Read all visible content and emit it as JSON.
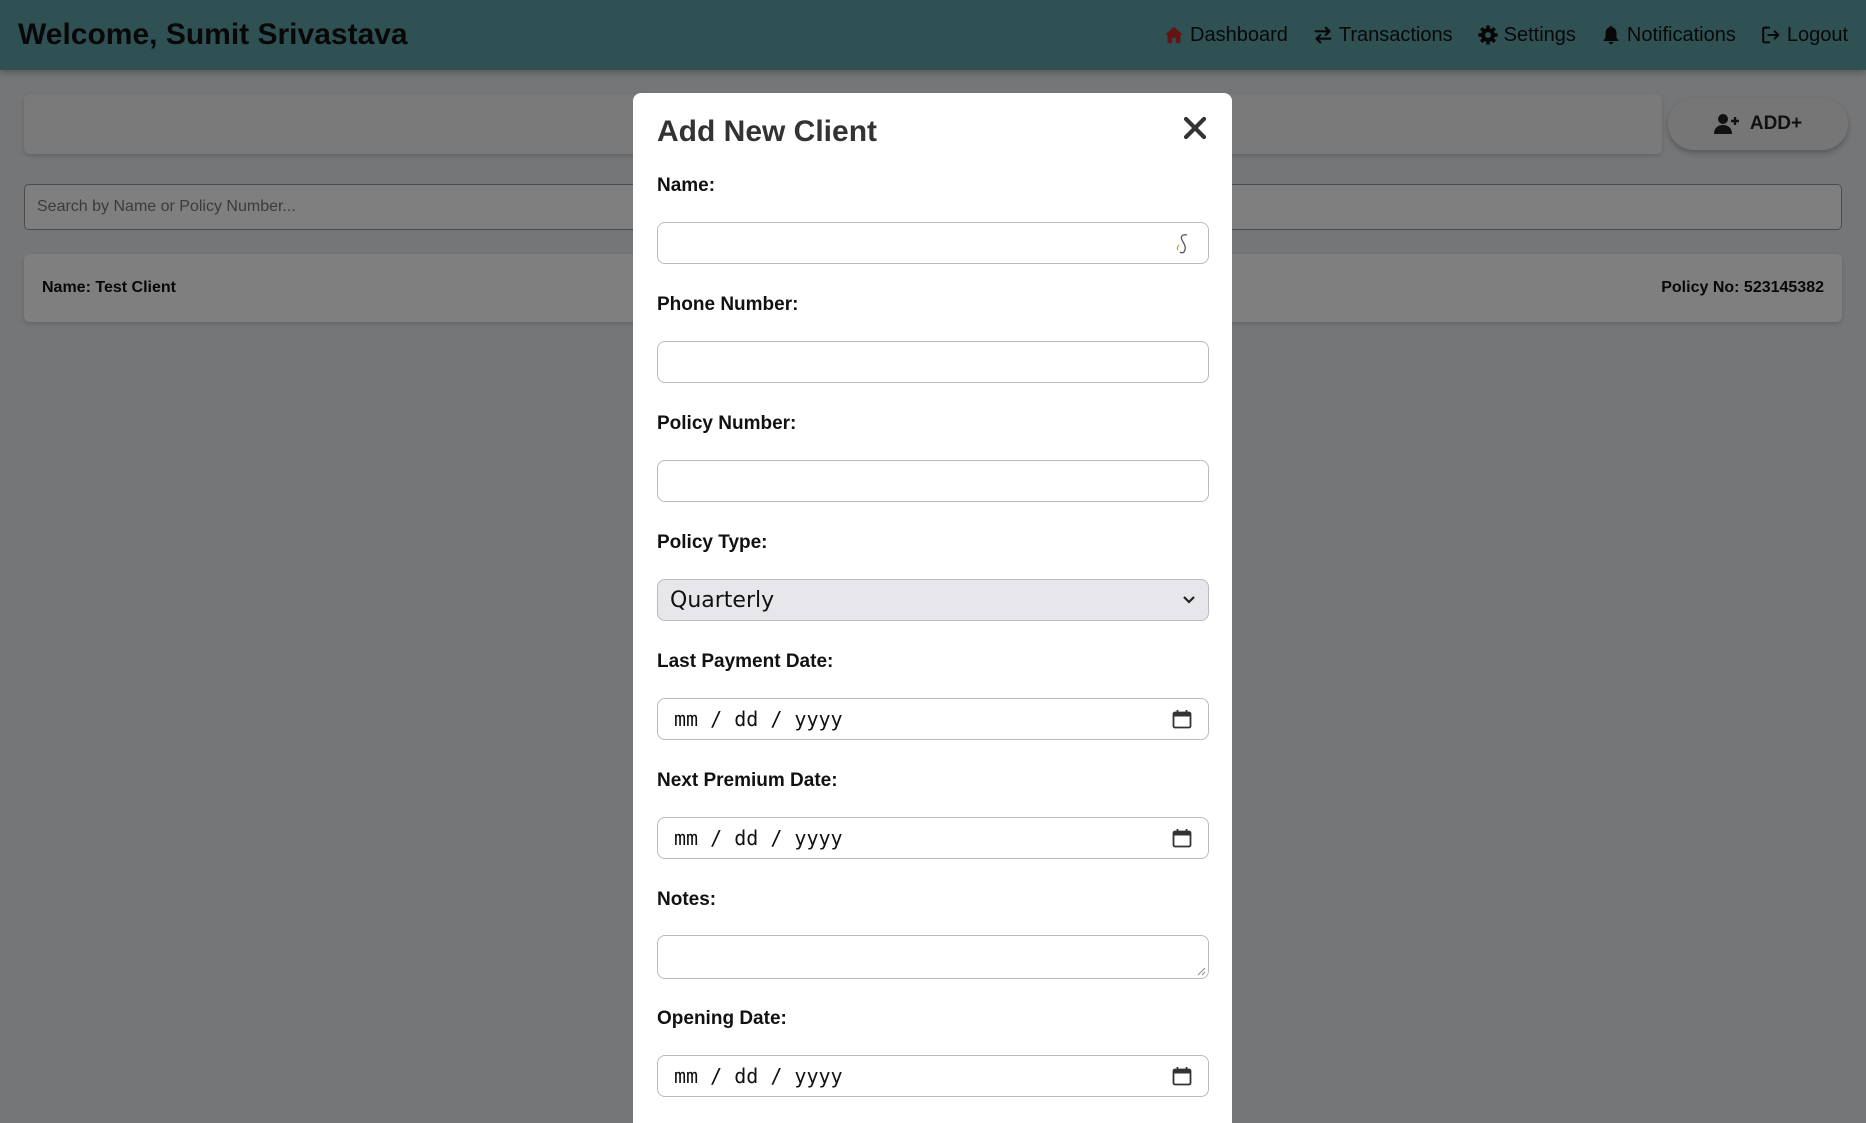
{
  "header": {
    "welcome": "Welcome, Sumit Srivastava",
    "nav": {
      "dashboard": "Dashboard",
      "transactions": "Transactions",
      "settings": "Settings",
      "notifications": "Notifications",
      "logout": "Logout"
    }
  },
  "toolbar": {
    "add_label": "ADD+"
  },
  "search": {
    "placeholder": "Search by Name or Policy Number..."
  },
  "client_card": {
    "name": "Name: Test Client",
    "policy": "Policy No: 523145382"
  },
  "modal": {
    "title": "Add New Client",
    "fields": {
      "name_label": "Name:",
      "phone_label": "Phone Number:",
      "policy_number_label": "Policy Number:",
      "policy_type_label": "Policy Type:",
      "policy_type_value": "Quarterly",
      "last_payment_label": "Last Payment Date:",
      "last_payment_placeholder": "mm / dd / yyyy",
      "next_premium_label": "Next Premium Date:",
      "next_premium_placeholder": "mm / dd / yyyy",
      "notes_label": "Notes:",
      "opening_date_label": "Opening Date:",
      "opening_date_placeholder": "mm / dd / yyyy"
    }
  },
  "colors": {
    "navbar": "#5fa3a9",
    "home_icon": "#c62828",
    "overlay": "rgba(0,0,0,0.5)"
  },
  "icons": [
    "home-icon",
    "transfer-icon",
    "gear-icon",
    "bell-icon",
    "logout-icon",
    "add-user-icon",
    "close-icon",
    "calendar-icon"
  ]
}
